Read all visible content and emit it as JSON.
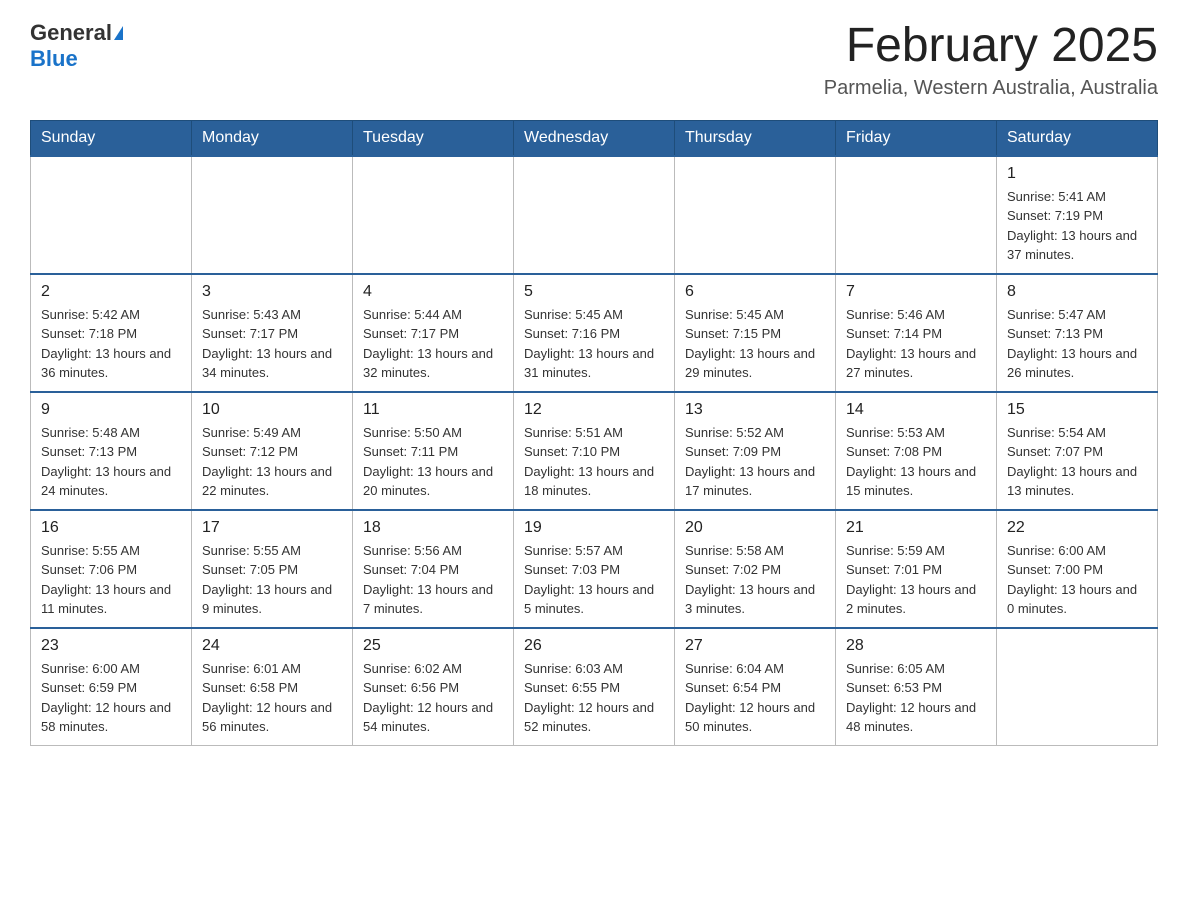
{
  "header": {
    "logo_general": "General",
    "logo_blue": "Blue",
    "month_title": "February 2025",
    "location": "Parmelia, Western Australia, Australia"
  },
  "weekdays": [
    "Sunday",
    "Monday",
    "Tuesday",
    "Wednesday",
    "Thursday",
    "Friday",
    "Saturday"
  ],
  "weeks": [
    {
      "days": [
        {
          "number": "",
          "info": ""
        },
        {
          "number": "",
          "info": ""
        },
        {
          "number": "",
          "info": ""
        },
        {
          "number": "",
          "info": ""
        },
        {
          "number": "",
          "info": ""
        },
        {
          "number": "",
          "info": ""
        },
        {
          "number": "1",
          "info": "Sunrise: 5:41 AM\nSunset: 7:19 PM\nDaylight: 13 hours and 37 minutes."
        }
      ]
    },
    {
      "days": [
        {
          "number": "2",
          "info": "Sunrise: 5:42 AM\nSunset: 7:18 PM\nDaylight: 13 hours and 36 minutes."
        },
        {
          "number": "3",
          "info": "Sunrise: 5:43 AM\nSunset: 7:17 PM\nDaylight: 13 hours and 34 minutes."
        },
        {
          "number": "4",
          "info": "Sunrise: 5:44 AM\nSunset: 7:17 PM\nDaylight: 13 hours and 32 minutes."
        },
        {
          "number": "5",
          "info": "Sunrise: 5:45 AM\nSunset: 7:16 PM\nDaylight: 13 hours and 31 minutes."
        },
        {
          "number": "6",
          "info": "Sunrise: 5:45 AM\nSunset: 7:15 PM\nDaylight: 13 hours and 29 minutes."
        },
        {
          "number": "7",
          "info": "Sunrise: 5:46 AM\nSunset: 7:14 PM\nDaylight: 13 hours and 27 minutes."
        },
        {
          "number": "8",
          "info": "Sunrise: 5:47 AM\nSunset: 7:13 PM\nDaylight: 13 hours and 26 minutes."
        }
      ]
    },
    {
      "days": [
        {
          "number": "9",
          "info": "Sunrise: 5:48 AM\nSunset: 7:13 PM\nDaylight: 13 hours and 24 minutes."
        },
        {
          "number": "10",
          "info": "Sunrise: 5:49 AM\nSunset: 7:12 PM\nDaylight: 13 hours and 22 minutes."
        },
        {
          "number": "11",
          "info": "Sunrise: 5:50 AM\nSunset: 7:11 PM\nDaylight: 13 hours and 20 minutes."
        },
        {
          "number": "12",
          "info": "Sunrise: 5:51 AM\nSunset: 7:10 PM\nDaylight: 13 hours and 18 minutes."
        },
        {
          "number": "13",
          "info": "Sunrise: 5:52 AM\nSunset: 7:09 PM\nDaylight: 13 hours and 17 minutes."
        },
        {
          "number": "14",
          "info": "Sunrise: 5:53 AM\nSunset: 7:08 PM\nDaylight: 13 hours and 15 minutes."
        },
        {
          "number": "15",
          "info": "Sunrise: 5:54 AM\nSunset: 7:07 PM\nDaylight: 13 hours and 13 minutes."
        }
      ]
    },
    {
      "days": [
        {
          "number": "16",
          "info": "Sunrise: 5:55 AM\nSunset: 7:06 PM\nDaylight: 13 hours and 11 minutes."
        },
        {
          "number": "17",
          "info": "Sunrise: 5:55 AM\nSunset: 7:05 PM\nDaylight: 13 hours and 9 minutes."
        },
        {
          "number": "18",
          "info": "Sunrise: 5:56 AM\nSunset: 7:04 PM\nDaylight: 13 hours and 7 minutes."
        },
        {
          "number": "19",
          "info": "Sunrise: 5:57 AM\nSunset: 7:03 PM\nDaylight: 13 hours and 5 minutes."
        },
        {
          "number": "20",
          "info": "Sunrise: 5:58 AM\nSunset: 7:02 PM\nDaylight: 13 hours and 3 minutes."
        },
        {
          "number": "21",
          "info": "Sunrise: 5:59 AM\nSunset: 7:01 PM\nDaylight: 13 hours and 2 minutes."
        },
        {
          "number": "22",
          "info": "Sunrise: 6:00 AM\nSunset: 7:00 PM\nDaylight: 13 hours and 0 minutes."
        }
      ]
    },
    {
      "days": [
        {
          "number": "23",
          "info": "Sunrise: 6:00 AM\nSunset: 6:59 PM\nDaylight: 12 hours and 58 minutes."
        },
        {
          "number": "24",
          "info": "Sunrise: 6:01 AM\nSunset: 6:58 PM\nDaylight: 12 hours and 56 minutes."
        },
        {
          "number": "25",
          "info": "Sunrise: 6:02 AM\nSunset: 6:56 PM\nDaylight: 12 hours and 54 minutes."
        },
        {
          "number": "26",
          "info": "Sunrise: 6:03 AM\nSunset: 6:55 PM\nDaylight: 12 hours and 52 minutes."
        },
        {
          "number": "27",
          "info": "Sunrise: 6:04 AM\nSunset: 6:54 PM\nDaylight: 12 hours and 50 minutes."
        },
        {
          "number": "28",
          "info": "Sunrise: 6:05 AM\nSunset: 6:53 PM\nDaylight: 12 hours and 48 minutes."
        },
        {
          "number": "",
          "info": ""
        }
      ]
    }
  ]
}
